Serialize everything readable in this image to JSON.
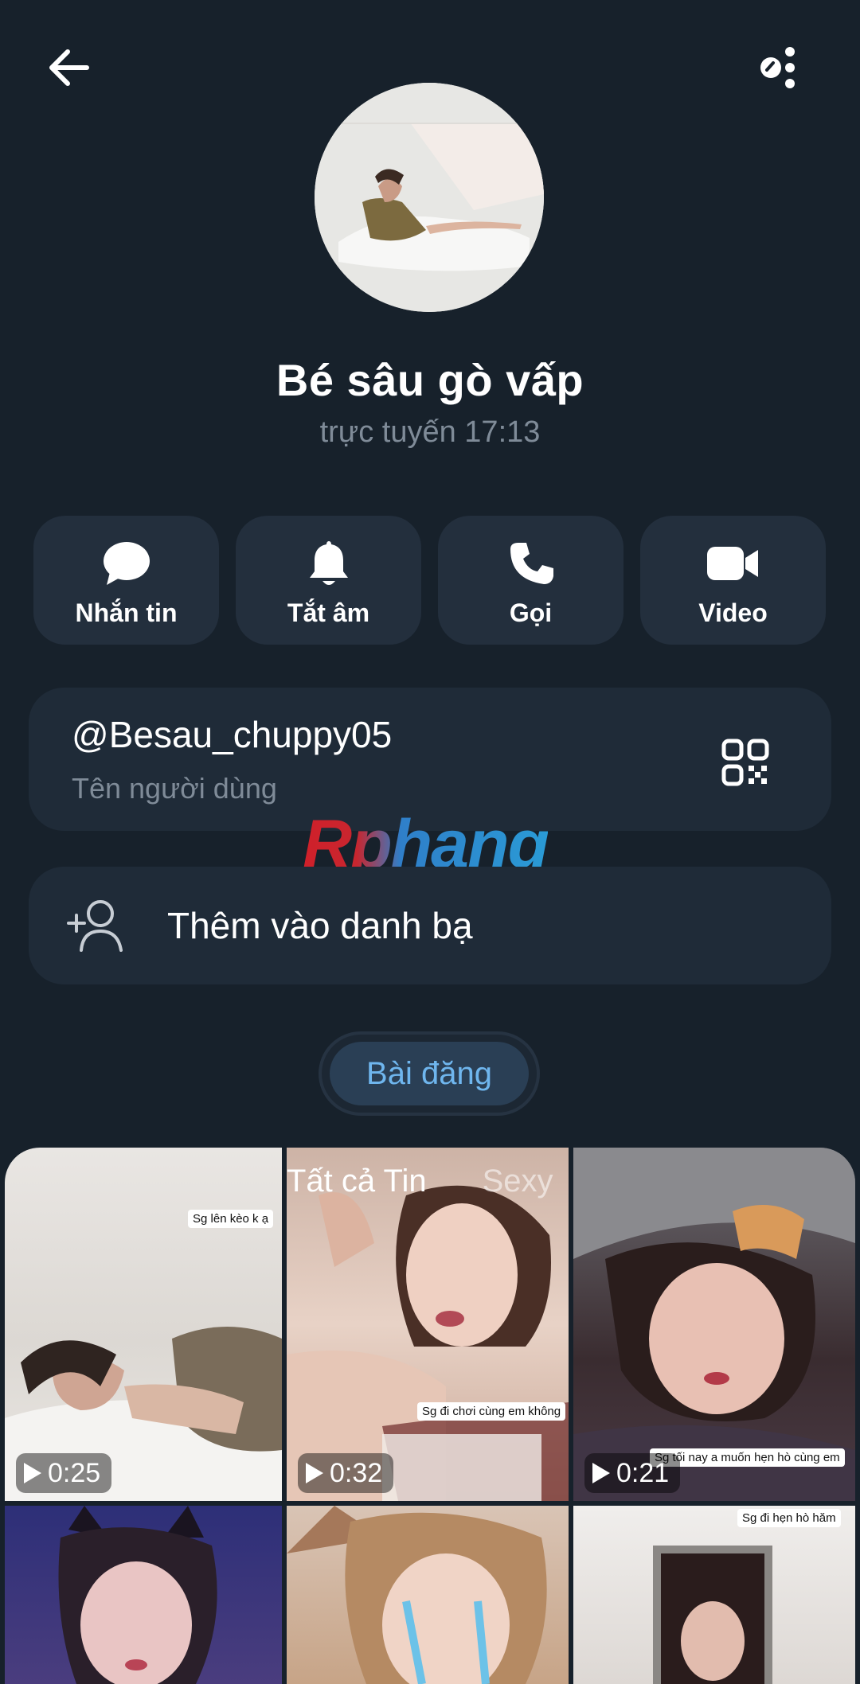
{
  "profile": {
    "name": "Bé sâu gò vấp",
    "status": "trực tuyến 17:13"
  },
  "actions": [
    {
      "label": "Nhắn tin",
      "icon": "message-icon"
    },
    {
      "label": "Tắt âm",
      "icon": "bell-icon"
    },
    {
      "label": "Gọi",
      "icon": "phone-icon"
    },
    {
      "label": "Video",
      "icon": "video-icon"
    }
  ],
  "username_card": {
    "username": "@Besau_chuppy05",
    "subtitle": "Tên người dùng",
    "icon": "qr-code-icon"
  },
  "add_contact": {
    "label": "Thêm vào danh bạ",
    "icon": "add-user-icon"
  },
  "watermark": "Rphang",
  "tabs": {
    "active": "Bài đăng"
  },
  "story_tabs": [
    "Tất cả Tin",
    "Sexy"
  ],
  "media": [
    {
      "duration": "0:25",
      "caption": "Sg lên kèo k ạ"
    },
    {
      "duration": "0:32",
      "caption": "Sg đi chơi cùng em không"
    },
    {
      "duration": "0:21",
      "caption": "Sg tối nay a muốn hẹn hò cùng em"
    },
    {
      "duration": "",
      "caption": ""
    },
    {
      "duration": "",
      "caption": ""
    },
    {
      "duration": "",
      "caption": "Sg đi hẹn hò hăm"
    }
  ],
  "colors": {
    "background": "#17212b",
    "card": "#1f2b38",
    "accent": "#6fb6ee",
    "muted": "#7f8b98"
  }
}
